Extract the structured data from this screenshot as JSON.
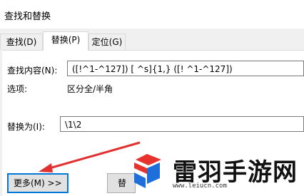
{
  "window": {
    "title": "查找和替换"
  },
  "tabs": [
    {
      "label": "查找",
      "key": "(D)"
    },
    {
      "label": "替换",
      "key": "(P)"
    },
    {
      "label": "定位",
      "key": "(G)"
    }
  ],
  "find": {
    "label": "查找内容(N):",
    "value": "([!^1-^127]) [ ^s]{1,} ([! ^1-^127])"
  },
  "options": {
    "label": "选项:",
    "value": "区分全/半角"
  },
  "replace": {
    "label": "替换为(I):",
    "value": "\\1\\2"
  },
  "buttons": {
    "more_label": "更多(M) >>",
    "replace_label": "替"
  },
  "watermark": {
    "brand": "雷羽手游网",
    "url": "www.leiucn.com"
  },
  "colors": {
    "accent": "#0078d7",
    "arrow": "#e03030",
    "logo_red": "#e8322e",
    "logo_blue": "#1e6fd9"
  }
}
